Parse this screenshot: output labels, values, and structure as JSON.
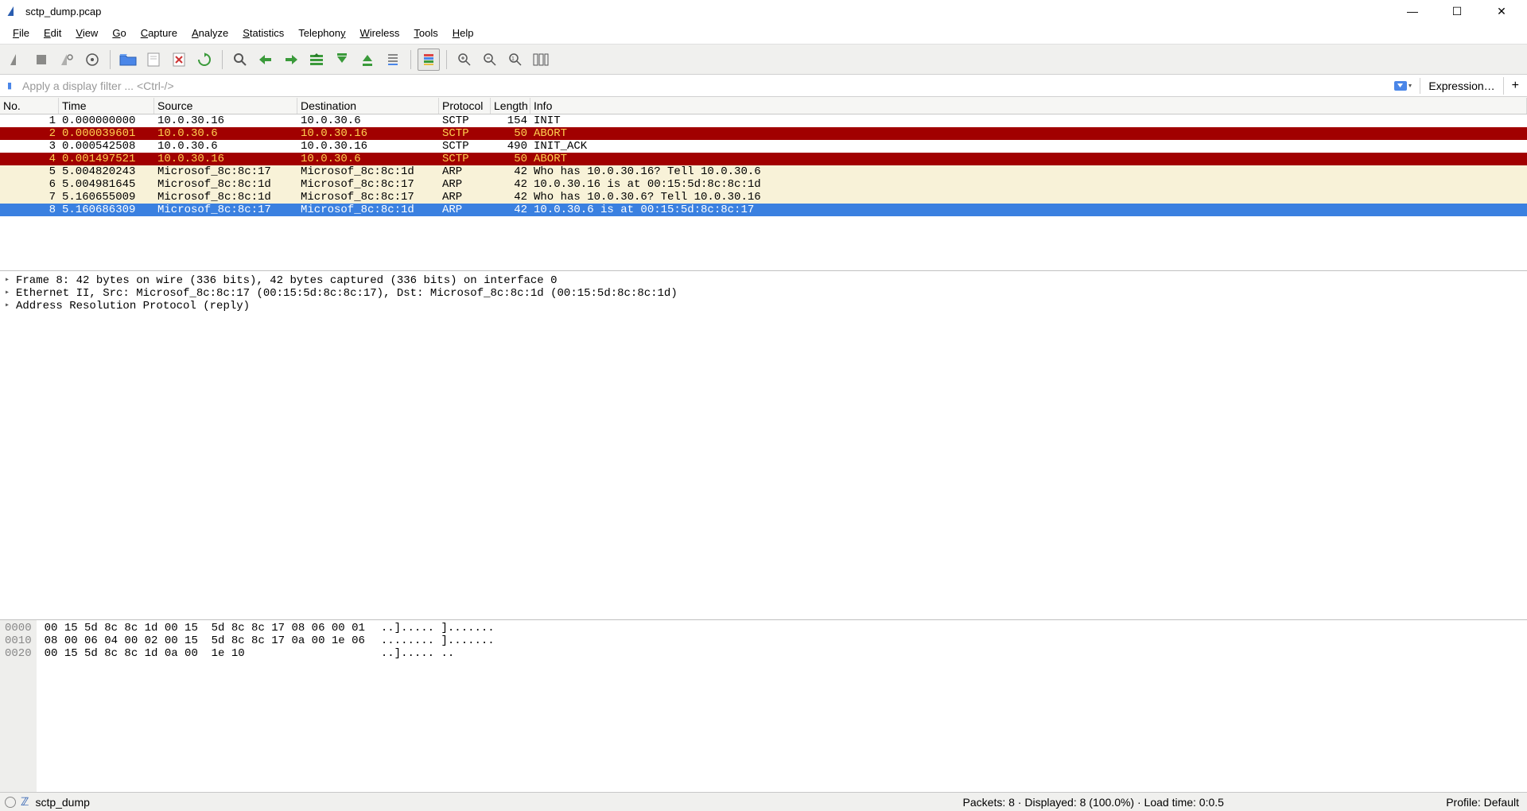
{
  "title": "sctp_dump.pcap",
  "window_buttons": {
    "min": "—",
    "max": "☐",
    "close": "✕"
  },
  "menus": [
    "File",
    "Edit",
    "View",
    "Go",
    "Capture",
    "Analyze",
    "Statistics",
    "Telephony",
    "Wireless",
    "Tools",
    "Help"
  ],
  "toolbar_icons": [
    "capture-start",
    "capture-stop",
    "capture-restart",
    "capture-options",
    "sep",
    "open-file",
    "save-file",
    "close-file",
    "reload",
    "sep",
    "find",
    "go-back",
    "go-forward",
    "go-first",
    "go-prev",
    "go-next",
    "go-last",
    "sep",
    "auto-scroll",
    "sep",
    "zoom-in",
    "zoom-out",
    "zoom-reset",
    "resize-columns"
  ],
  "filter": {
    "placeholder": "Apply a display filter ... <Ctrl-/>",
    "expression": "Expression…",
    "plus": "+"
  },
  "columns": [
    "No.",
    "Time",
    "Source",
    "Destination",
    "Protocol",
    "Length",
    "Info"
  ],
  "packets": [
    {
      "no": "1",
      "time": "0.000000000",
      "src": "10.0.30.16",
      "dst": "10.0.30.6",
      "proto": "SCTP",
      "len": "154",
      "info": "INIT",
      "cls": ""
    },
    {
      "no": "2",
      "time": "0.000039601",
      "src": "10.0.30.6",
      "dst": "10.0.30.16",
      "proto": "SCTP",
      "len": "50",
      "info": "ABORT",
      "cls": "r-red"
    },
    {
      "no": "3",
      "time": "0.000542508",
      "src": "10.0.30.6",
      "dst": "10.0.30.16",
      "proto": "SCTP",
      "len": "490",
      "info": "INIT_ACK",
      "cls": ""
    },
    {
      "no": "4",
      "time": "0.001497521",
      "src": "10.0.30.16",
      "dst": "10.0.30.6",
      "proto": "SCTP",
      "len": "50",
      "info": "ABORT",
      "cls": "r-red"
    },
    {
      "no": "5",
      "time": "5.004820243",
      "src": "Microsof_8c:8c:17",
      "dst": "Microsof_8c:8c:1d",
      "proto": "ARP",
      "len": "42",
      "info": "Who has 10.0.30.16? Tell 10.0.30.6",
      "cls": "r-yel"
    },
    {
      "no": "6",
      "time": "5.004981645",
      "src": "Microsof_8c:8c:1d",
      "dst": "Microsof_8c:8c:17",
      "proto": "ARP",
      "len": "42",
      "info": "10.0.30.16 is at 00:15:5d:8c:8c:1d",
      "cls": "r-yel"
    },
    {
      "no": "7",
      "time": "5.160655009",
      "src": "Microsof_8c:8c:1d",
      "dst": "Microsof_8c:8c:17",
      "proto": "ARP",
      "len": "42",
      "info": "Who has 10.0.30.6? Tell 10.0.30.16",
      "cls": "r-yel"
    },
    {
      "no": "8",
      "time": "5.160686309",
      "src": "Microsof_8c:8c:17",
      "dst": "Microsof_8c:8c:1d",
      "proto": "ARP",
      "len": "42",
      "info": "10.0.30.6 is at 00:15:5d:8c:8c:17",
      "cls": "r-sel"
    }
  ],
  "details": [
    "Frame 8: 42 bytes on wire (336 bits), 42 bytes captured (336 bits) on interface 0",
    "Ethernet II, Src: Microsof_8c:8c:17 (00:15:5d:8c:8c:17), Dst: Microsof_8c:8c:1d (00:15:5d:8c:8c:1d)",
    "Address Resolution Protocol (reply)"
  ],
  "hex": [
    {
      "off": "0000",
      "b": "00 15 5d 8c 8c 1d 00 15  5d 8c 8c 17 08 06 00 01",
      "a": "..]..... ]......."
    },
    {
      "off": "0010",
      "b": "08 00 06 04 00 02 00 15  5d 8c 8c 17 0a 00 1e 06",
      "a": "........ ]......."
    },
    {
      "off": "0020",
      "b": "00 15 5d 8c 8c 1d 0a 00  1e 10",
      "a": "..]..... .."
    }
  ],
  "status": {
    "left": "sctp_dump",
    "mid": "Packets: 8 · Displayed: 8 (100.0%) · Load time: 0:0.5",
    "right": "Profile: Default"
  }
}
